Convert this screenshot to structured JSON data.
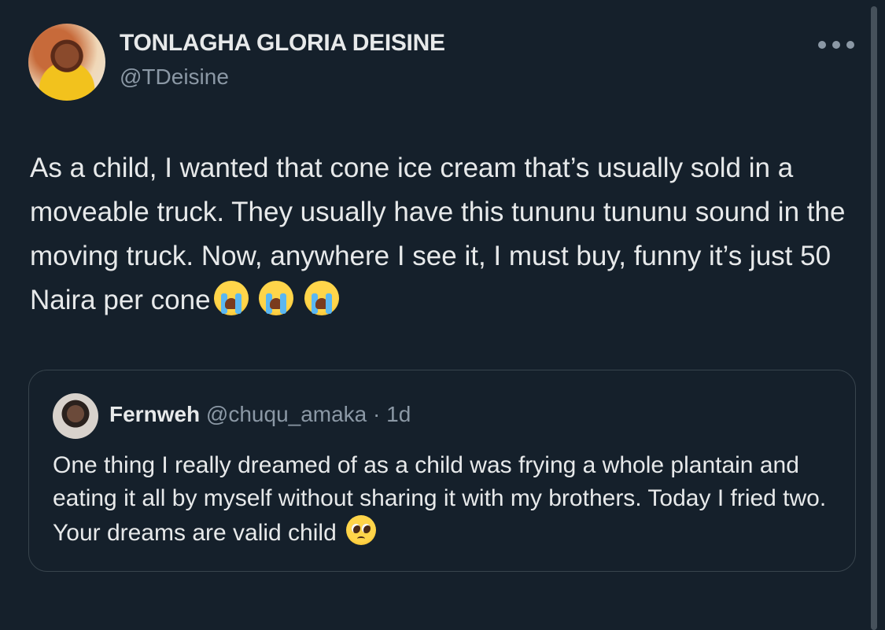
{
  "tweet": {
    "display_name": "TONLAGHA GLORIA DEISINE",
    "handle": "@TDeisine",
    "text": "As a child, I wanted that cone ice cream that’s usually sold in a moveable truck. They usually have this tununu tununu sound in the moving truck. Now, anywhere I see it, I must buy, funny it’s just 50 Naira per cone",
    "emojis": [
      "loudly-crying-face",
      "loudly-crying-face",
      "loudly-crying-face"
    ]
  },
  "quoted": {
    "display_name": "Fernweh",
    "handle": "@chuqu_amaka",
    "separator": "·",
    "time": "1d",
    "text": "One thing I really dreamed of as a child was frying a whole plantain and eating it all by myself without sharing it with my brothers. Today I fried two. Your dreams are valid child",
    "emoji": "pleading-face"
  },
  "colors": {
    "background": "#15202b",
    "text_primary": "#e7e9ea",
    "text_secondary": "#8b98a5",
    "border": "#38444d"
  },
  "icons": {
    "more": "more-horizontal-icon"
  }
}
